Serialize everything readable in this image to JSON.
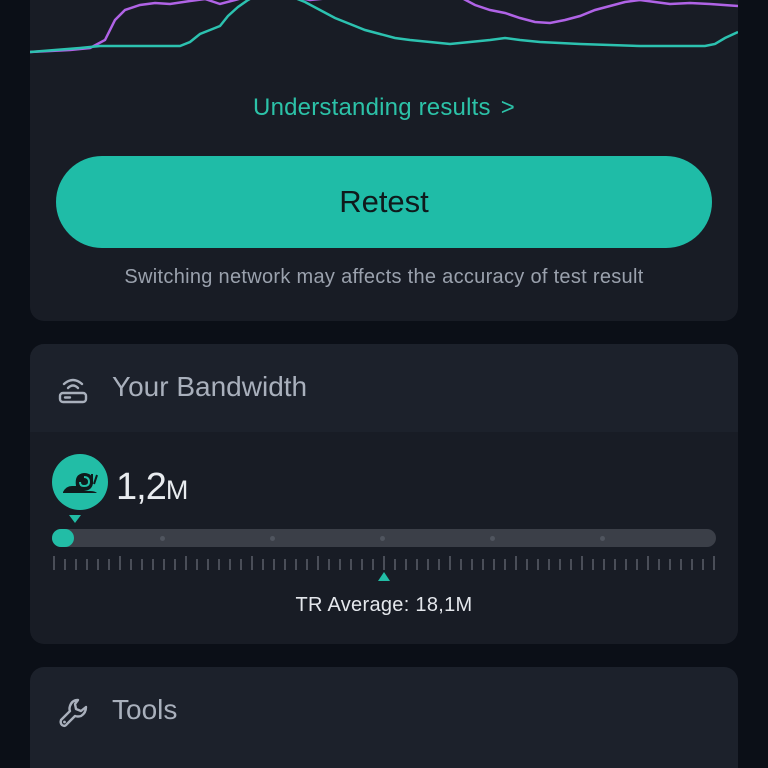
{
  "result": {
    "understanding_link": "Understanding results",
    "understanding_chevron": ">",
    "retest_label": "Retest",
    "note": "Switching network may affects the accuracy of test result"
  },
  "graph_colors": {
    "upload": "#b063e6",
    "download": "#2cc2b0"
  },
  "bandwidth": {
    "title": "Your Bandwidth",
    "icon": "router-icon",
    "badge_icon": "snail-icon",
    "value": "1,2",
    "unit": "M",
    "progress_fraction": 0.033,
    "average_label": "TR Average: 18,1M",
    "accent": "#22bda6"
  },
  "tools": {
    "title": "Tools",
    "icon": "wrench-icon"
  }
}
